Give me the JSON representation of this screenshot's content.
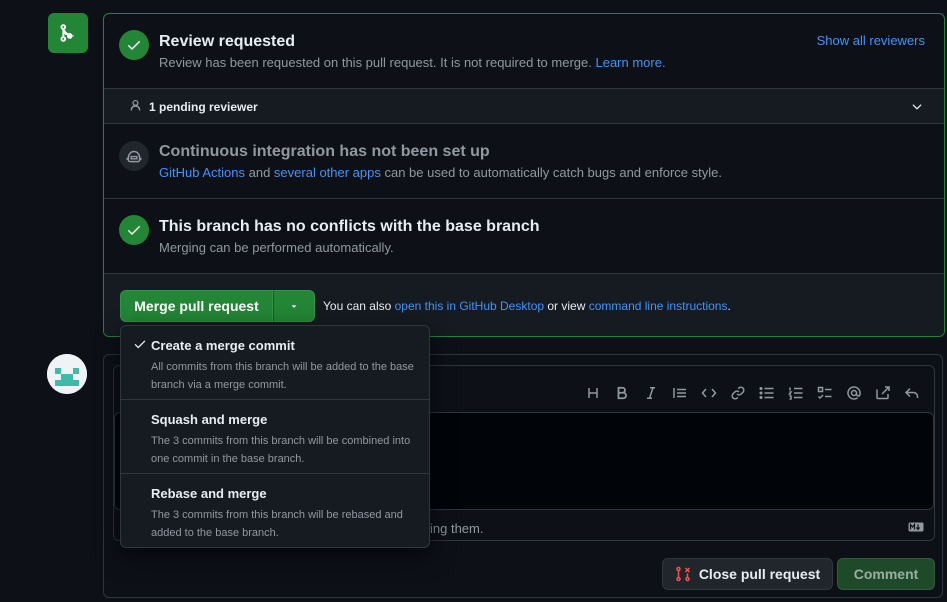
{
  "review": {
    "title": "Review requested",
    "desc": "Review has been requested on this pull request. It is not required to merge.",
    "learn_more": "Learn more.",
    "show_all": "Show all reviewers"
  },
  "pending": {
    "label": "1 pending reviewer"
  },
  "ci": {
    "title": "Continuous integration has not been set up",
    "link1": "GitHub Actions",
    "and": " and ",
    "link2": "several other apps",
    "rest": " can be used to automatically catch bugs and enforce style."
  },
  "conflicts": {
    "title": "This branch has no conflicts with the base branch",
    "desc": "Merging can be performed automatically."
  },
  "merge": {
    "button": "Merge pull request",
    "hint_prefix": "You can also ",
    "hint_link1": "open this in GitHub Desktop",
    "hint_mid": " or view ",
    "hint_link2": "command line instructions",
    "hint_suffix": "."
  },
  "dropdown": {
    "items": [
      {
        "title": "Create a merge commit",
        "desc": "All commits from this branch will be added to the base branch via a merge commit.",
        "selected": true
      },
      {
        "title": "Squash and merge",
        "desc": "The 3 commits from this branch will be combined into one commit in the base branch.",
        "selected": false
      },
      {
        "title": "Rebase and merge",
        "desc": "The 3 commits from this branch will be rebased and added to the base branch.",
        "selected": false
      }
    ]
  },
  "comment": {
    "footer_fragment": "ing them.",
    "close_button": "Close pull request",
    "comment_button": "Comment",
    "markdown_badge": "MD"
  },
  "colors": {
    "accent_green": "#238636",
    "link_blue": "#4493f8",
    "close_icon_red": "#f85149"
  }
}
